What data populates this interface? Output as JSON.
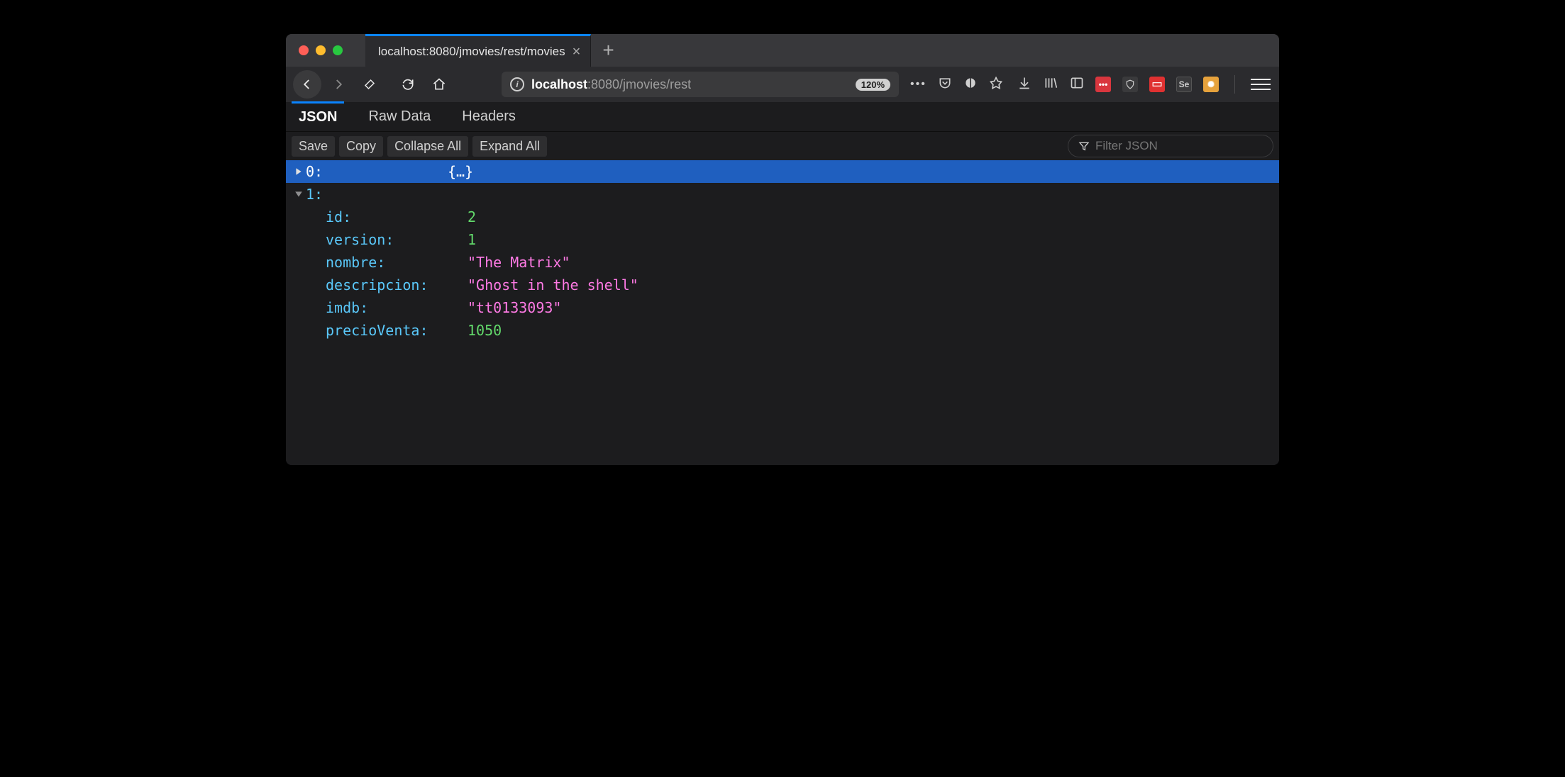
{
  "tab": {
    "title": "localhost:8080/jmovies/rest/movies"
  },
  "url": {
    "host": "localhost",
    "path": ":8080/jmovies/rest",
    "zoom": "120%"
  },
  "viewer_tabs": {
    "json": "JSON",
    "raw": "Raw Data",
    "headers": "Headers"
  },
  "actions": {
    "save": "Save",
    "copy": "Copy",
    "collapse": "Collapse All",
    "expand": "Expand All"
  },
  "filter": {
    "placeholder": "Filter JSON"
  },
  "json": {
    "row0": {
      "key": "0:",
      "val": "{…}"
    },
    "row1": {
      "key": "1:"
    },
    "fields": {
      "id": {
        "key": "id:",
        "val": "2"
      },
      "version": {
        "key": "version:",
        "val": "1"
      },
      "nombre": {
        "key": "nombre:",
        "val": "\"The Matrix\""
      },
      "descripcion": {
        "key": "descripcion:",
        "val": "\"Ghost in the shell\""
      },
      "imdb": {
        "key": "imdb:",
        "val": "\"tt0133093\""
      },
      "precioVenta": {
        "key": "precioVenta:",
        "val": "1050"
      }
    }
  }
}
